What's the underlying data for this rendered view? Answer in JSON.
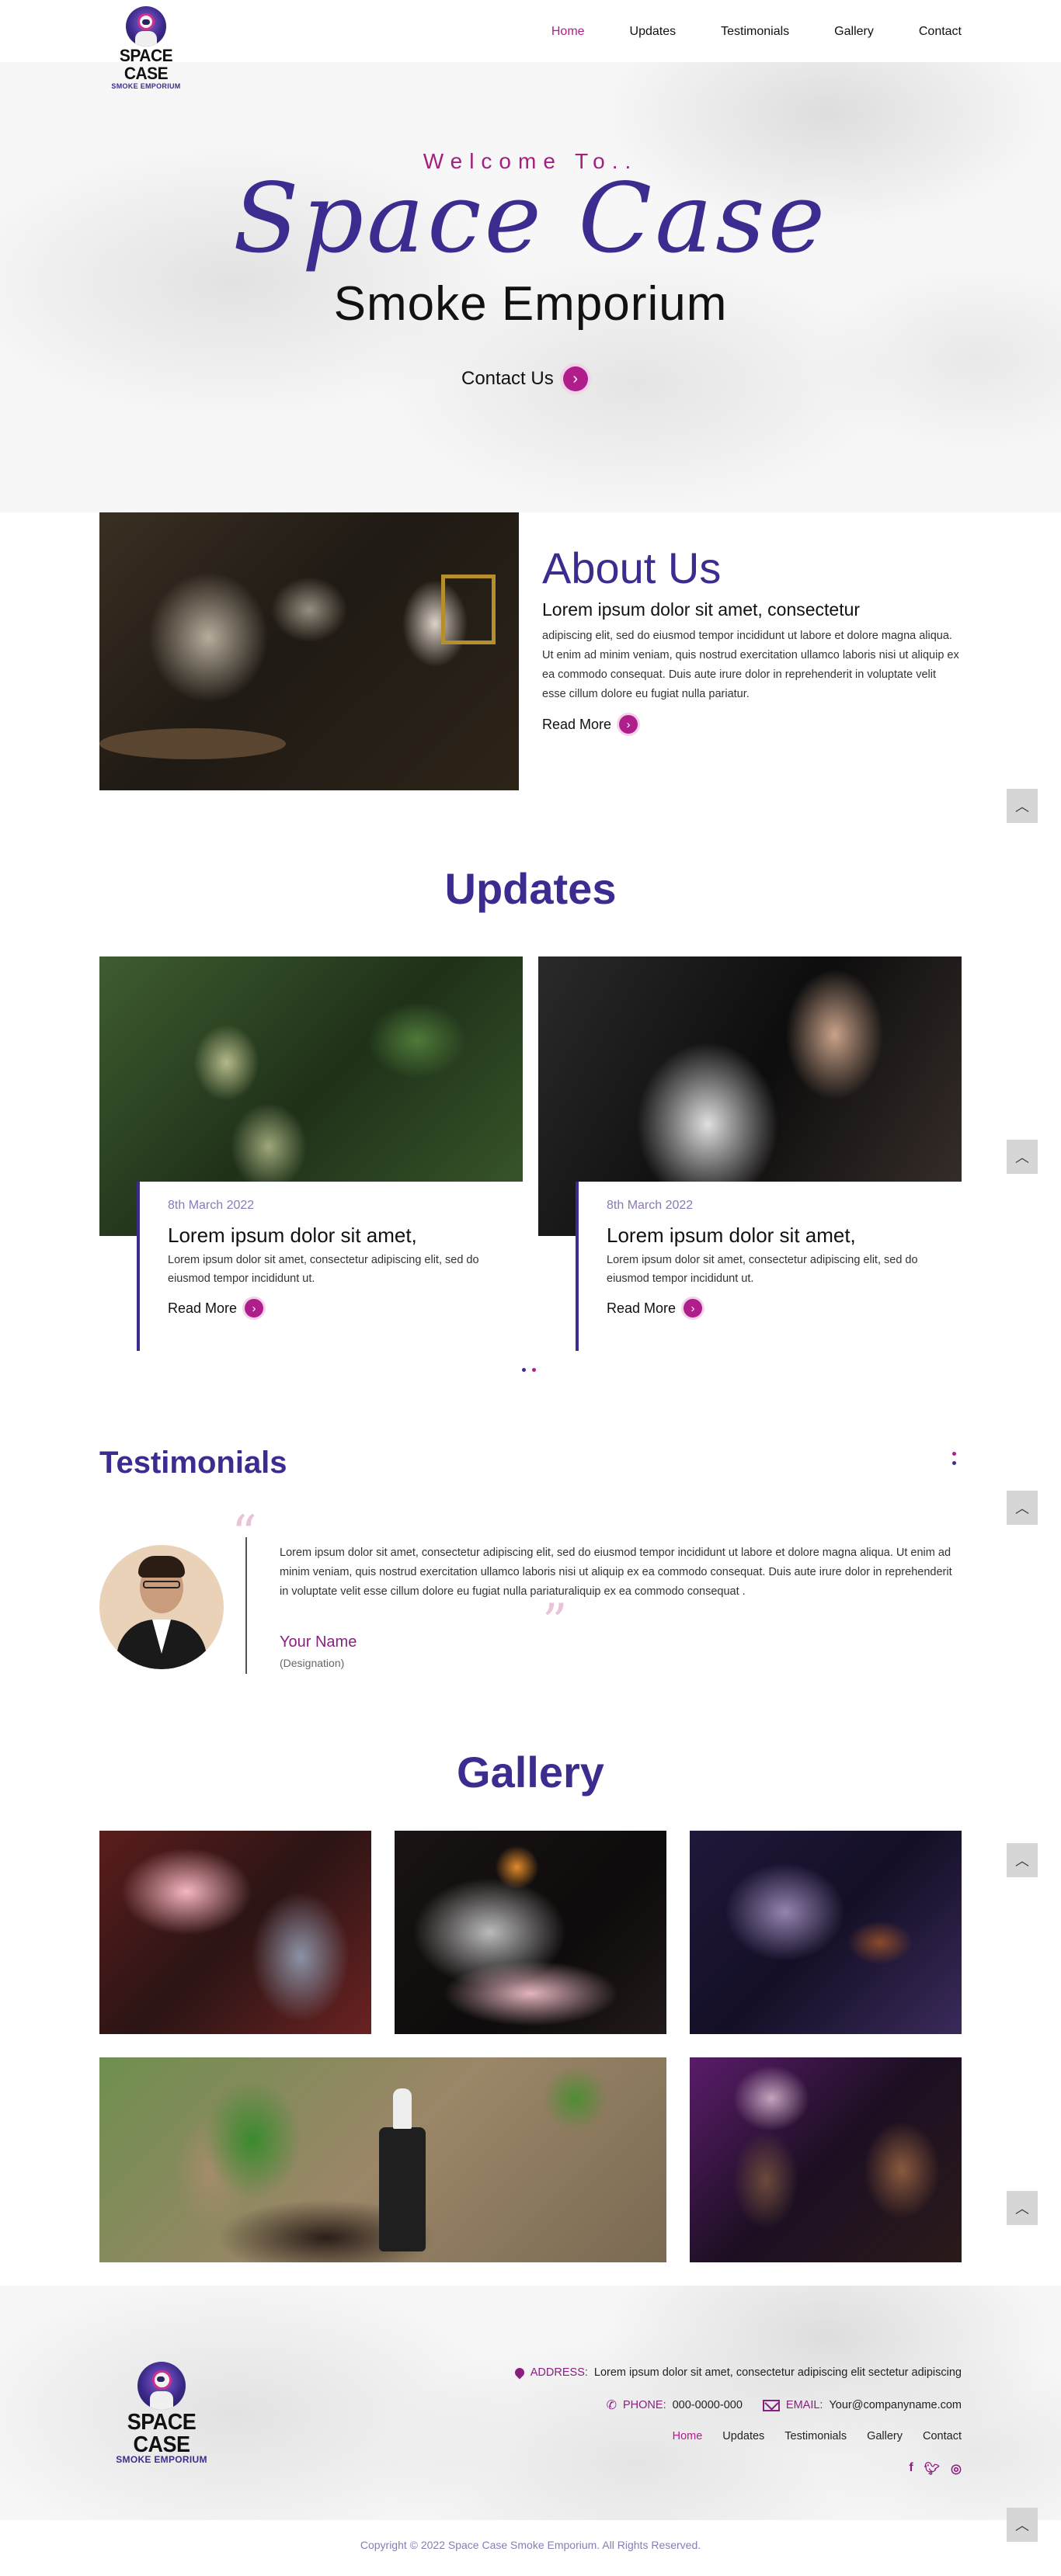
{
  "nav": {
    "logo_name": "SPACE CASE",
    "logo_sub": "SMOKE EMPORIUM",
    "links": [
      "Home",
      "Updates",
      "Testimonials",
      "Gallery",
      "Contact"
    ]
  },
  "hero": {
    "welcome": "Welcome To..",
    "script_title": "Space Case",
    "subtitle": "Smoke Emporium",
    "cta": "Contact Us"
  },
  "about": {
    "title": "About Us",
    "lead": "Lorem ipsum dolor sit amet, consectetur",
    "body": "adipiscing elit, sed do eiusmod tempor incididunt ut labore et dolore magna aliqua. Ut enim ad minim veniam, quis nostrud exercitation ullamco laboris nisi ut aliquip ex ea commodo consequat. Duis aute irure dolor in reprehenderit in voluptate velit esse cillum dolore eu fugiat nulla pariatur.",
    "read_more": "Read More"
  },
  "updates": {
    "title": "Updates",
    "cards": [
      {
        "date": "8th March 2022",
        "title": "Lorem ipsum dolor sit amet,",
        "body": "Lorem ipsum dolor sit amet, consectetur adipiscing elit, sed do eiusmod tempor incididunt ut.",
        "read_more": "Read More"
      },
      {
        "date": "8th March 2022",
        "title": "Lorem ipsum dolor sit amet,",
        "body": "Lorem ipsum dolor sit amet, consectetur adipiscing elit, sed do eiusmod tempor incididunt ut.",
        "read_more": "Read More"
      }
    ]
  },
  "testimonials": {
    "title": "Testimonials",
    "text": "Lorem ipsum dolor sit amet, consectetur adipiscing elit, sed do eiusmod tempor incididunt ut labore et dolore magna aliqua. Ut enim ad minim veniam, quis nostrud exercitation ullamco laboris nisi ut aliquip ex ea commodo consequat. Duis aute irure dolor in reprehenderit in voluptate velit esse cillum dolore eu fugiat nulla pariaturaliquip ex ea commodo consequat .",
    "name": "Your Name",
    "designation": "(Designation)"
  },
  "gallery": {
    "title": "Gallery"
  },
  "footer": {
    "logo_name": "SPACE CASE",
    "logo_sub": "SMOKE EMPORIUM",
    "address_label": "ADDRESS:",
    "address": "Lorem ipsum dolor sit amet, consectetur adipiscing elit sectetur adipiscing",
    "phone_label": "PHONE:",
    "phone": "000-0000-000",
    "email_label": "EMAIL:",
    "email": "Your@companyname.com",
    "links": [
      "Home",
      "Updates",
      "Testimonials",
      "Gallery",
      "Contact"
    ],
    "social_icons": [
      "facebook-icon",
      "twitter-icon",
      "instagram-icon"
    ],
    "copyright": "Copyright © 2022 Space Case Smoke Emporium. All Rights Reserved."
  },
  "colors": {
    "brand_purple": "#3d2c8f",
    "accent_magenta": "#b01e8c",
    "footer_label": "#8a1f80"
  }
}
